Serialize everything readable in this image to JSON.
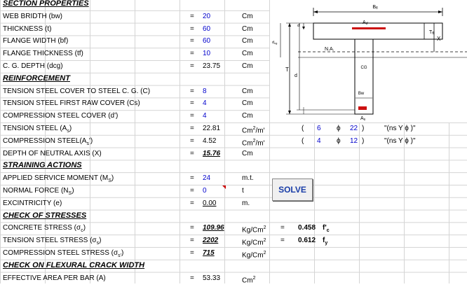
{
  "headers": {
    "section": "SECTION PROPERTIES",
    "reinf": "REINFORCEMENT",
    "straining": "STRAINING ACTIONS",
    "stresses": "CHECK OF STRESSES",
    "crack": "CHECK ON FLEXURAL CRACK WIDTH"
  },
  "rows": {
    "bw": {
      "label": "WEB BRIDTH (bw)",
      "eq": "=",
      "value": "20",
      "unit": "Cm"
    },
    "t": {
      "label": "THICKNESS (t)",
      "eq": "=",
      "value": "60",
      "unit": "Cm"
    },
    "bf": {
      "label": "FLANGE WIDTH (bf)",
      "eq": "=",
      "value": "60",
      "unit": "Cm"
    },
    "tf": {
      "label": "FLANGE THICKNESS (tf)",
      "eq": "=",
      "value": "10",
      "unit": "Cm"
    },
    "dcg": {
      "label": "C. G. DEPTH (dcg)",
      "eq": "=",
      "value": "23.75",
      "unit": "Cm"
    },
    "c": {
      "label": "TENSION STEEL COVER TO STEEL C. G. (C)",
      "eq": "=",
      "value": "8",
      "unit": "Cm"
    },
    "cs": {
      "label": "TENSION STEEL FIRST RAW COVER (Cs)",
      "eq": "=",
      "value": "4",
      "unit": "Cm"
    },
    "dprime": {
      "label": "COMPRESSION STEEL COVER (d')",
      "eq": "=",
      "value": "4",
      "unit": "Cm"
    },
    "as": {
      "label_main": "TENSION STEEL (A",
      "label_sub": "s",
      "label_end": ")",
      "eq": "=",
      "value": "22.81",
      "unit_main": "Cm",
      "unit_sup": "2",
      "unit_end": "/m'",
      "paren_open": "(",
      "n": "6",
      "phi": "ϕ",
      "dia": "22",
      "paren_close": ")",
      "ns": "\"(ns  Y  ϕ  )\""
    },
    "asp": {
      "label_main": "COMPRESSION STEEL(A",
      "label_sub": "s",
      "label_end": "')",
      "eq": "=",
      "value": "4.52",
      "unit_main": "Cm",
      "unit_sup": "2",
      "unit_end": "/m'",
      "paren_open": "(",
      "n": "4",
      "phi": "ϕ",
      "dia": "12",
      "paren_close": ")",
      "ns": "\"(ns  Y  ϕ  )\""
    },
    "x": {
      "label": "DEPTH OF NEUTRAL AXIS (X)",
      "eq": "=",
      "value": "15.76",
      "unit": "Cm"
    },
    "ms": {
      "label_main": "APPLIED SERVICE MOMENT (M",
      "label_sub": "S",
      "label_end": ")",
      "eq": "=",
      "value": "24",
      "unit": "m.t."
    },
    "ns": {
      "label_main": "NORMAL FORCE (N",
      "label_sub": "S",
      "label_end": ")",
      "eq": "=",
      "value": "0",
      "unit": "t"
    },
    "e": {
      "label": "EXCINTRICITY (e)",
      "eq": "=",
      "value": "0.00",
      "unit": "m."
    },
    "fc": {
      "label_main": "CONCRETE STRESS (σ",
      "label_sub": "c",
      "label_end": ")",
      "eq": "=",
      "value": "109.96",
      "unit_main": "Kg/Cm",
      "unit_sup": "2",
      "eq2": "=",
      "ratio": "0.458",
      "ratio_unit_main": "f'",
      "ratio_unit_sub": "c"
    },
    "fs": {
      "label_main": "TENSION STEEL STRESS (σ",
      "label_sub": "s",
      "label_end": ")",
      "eq": "=",
      "value": "2202",
      "unit_main": "Kg/Cm",
      "unit_sup": "2",
      "eq2": "=",
      "ratio": "0.612",
      "ratio_unit_main": "f",
      "ratio_unit_sub": "y"
    },
    "fsp": {
      "label_main": "COMPRESSION STEEL STRESS (σ",
      "label_sub": "s'",
      "label_end": ")",
      "eq": "=",
      "value": "715",
      "unit_main": "Kg/Cm",
      "unit_sup": "2"
    },
    "aeff": {
      "label": "EFFECTIVE AREA PER BAR (A)",
      "eq": "=",
      "value": "53.33",
      "unit_main": "Cm",
      "unit_sup": "2"
    }
  },
  "solve_label": "SOLVE",
  "diagram": {
    "bf": "B",
    "bf_sub": "fl",
    "asp": "A",
    "asp_sub": "s'",
    "tf": "T",
    "tf_sub": "fl",
    "x": "X",
    "dcg": "d",
    "dcg_sub": "cg",
    "na": "N.A.",
    "t": "T",
    "d": "d",
    "cg": "CG",
    "bw": "Bw",
    "as": "A",
    "as_sub": "s",
    "d1": "d'"
  }
}
